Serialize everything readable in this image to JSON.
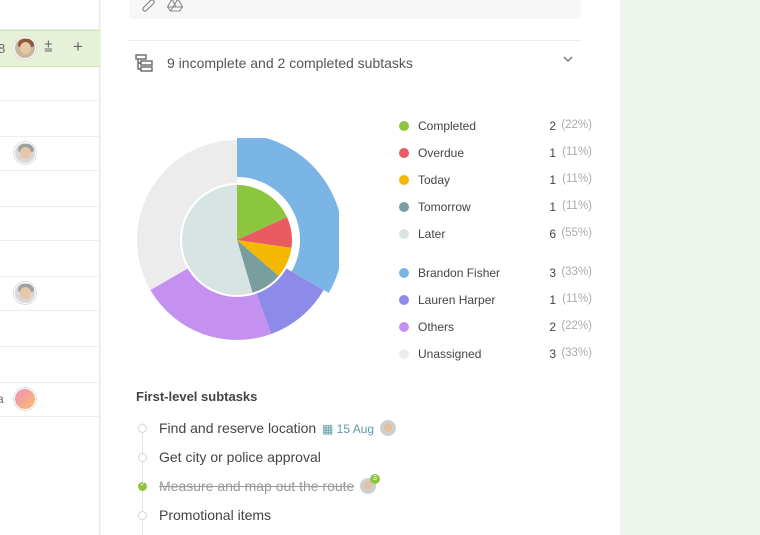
{
  "subtasks_summary": "9 incomplete and 2 completed subtasks",
  "status_legend": [
    {
      "label": "Completed",
      "count": "2",
      "pct": "(22%)",
      "color": "#8cc63f"
    },
    {
      "label": "Overdue",
      "count": "1",
      "pct": "(11%)",
      "color": "#ea5a61"
    },
    {
      "label": "Today",
      "count": "1",
      "pct": "(11%)",
      "color": "#f5b800"
    },
    {
      "label": "Tomorrow",
      "count": "1",
      "pct": "(11%)",
      "color": "#7a9e9d"
    },
    {
      "label": "Later",
      "count": "6",
      "pct": "(55%)",
      "color": "#d8e4e4"
    }
  ],
  "assignee_legend": [
    {
      "label": "Brandon Fisher",
      "count": "3",
      "pct": "(33%)",
      "color": "#7ab5e6"
    },
    {
      "label": "Lauren Harper",
      "count": "1",
      "pct": "(11%)",
      "color": "#8e8be8"
    },
    {
      "label": "Others",
      "count": "2",
      "pct": "(22%)",
      "color": "#c491f0"
    },
    {
      "label": "Unassigned",
      "count": "3",
      "pct": "(33%)",
      "color": "#ececec"
    }
  ],
  "first_level_title": "First-level subtasks",
  "subtasks": [
    {
      "title": "Find and reserve location",
      "due": "15 Aug",
      "completed": false,
      "has_avatar": true,
      "badge": ""
    },
    {
      "title": "Get city or police approval",
      "due": "",
      "completed": false,
      "has_avatar": false,
      "badge": ""
    },
    {
      "title": "Measure and map out the route",
      "due": "",
      "completed": true,
      "has_avatar": true,
      "badge": "3"
    },
    {
      "title": "Promotional items",
      "due": "",
      "completed": false,
      "has_avatar": false,
      "badge": ""
    }
  ],
  "icons": {
    "attachment": "paperclip-icon",
    "drive": "google-drive-icon",
    "subtask_tree": "subtask-tree-icon",
    "collapse": "chevron-down-icon",
    "calendar": "calendar-icon",
    "add_subtask": "add-subtask-icon",
    "add": "plus-icon"
  },
  "chart_data": {
    "type": "pie",
    "rings": [
      {
        "name": "status",
        "slices": [
          {
            "label": "Completed",
            "value": 2,
            "color": "#8cc63f"
          },
          {
            "label": "Overdue",
            "value": 1,
            "color": "#ea5a61"
          },
          {
            "label": "Today",
            "value": 1,
            "color": "#f5b800"
          },
          {
            "label": "Tomorrow",
            "value": 1,
            "color": "#7a9e9d"
          },
          {
            "label": "Later",
            "value": 6,
            "color": "#d8e4e4"
          }
        ]
      },
      {
        "name": "assignee",
        "slices": [
          {
            "label": "Brandon Fisher",
            "value": 3,
            "color": "#7ab5e6"
          },
          {
            "label": "Lauren Harper",
            "value": 1,
            "color": "#8e8be8"
          },
          {
            "label": "Others",
            "value": 2,
            "color": "#c491f0"
          },
          {
            "label": "Unassigned",
            "value": 3,
            "color": "#ececec"
          }
        ]
      }
    ]
  }
}
